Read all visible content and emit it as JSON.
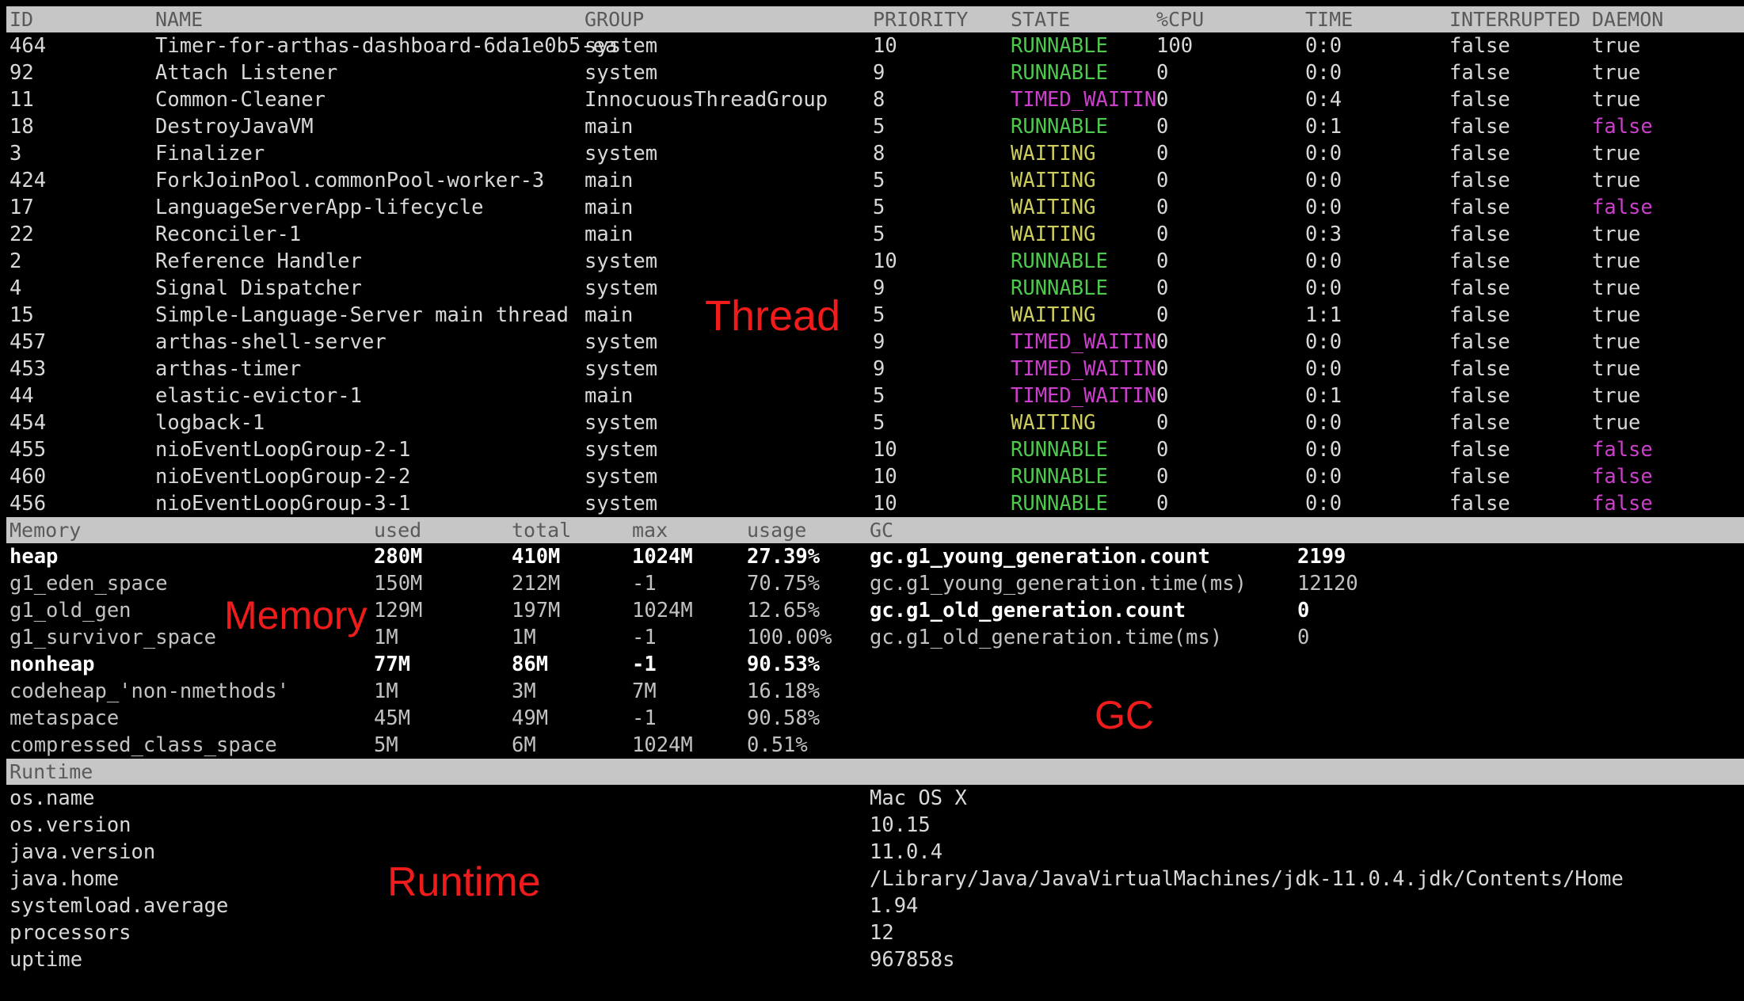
{
  "annotations": {
    "thread": "Thread",
    "memory": "Memory",
    "gc": "GC",
    "runtime": "Runtime",
    "color": "#f01c1c"
  },
  "thread_table": {
    "headers": {
      "id": "ID",
      "name": "NAME",
      "group": "GROUP",
      "priority": "PRIORITY",
      "state": "STATE",
      "cpu": "%CPU",
      "time": "TIME",
      "interrupted": "INTERRUPTED",
      "daemon": "DAEMON"
    },
    "rows": [
      {
        "id": "464",
        "name": "Timer-for-arthas-dashboard-6da1e0b5-ea",
        "group": "system",
        "priority": "10",
        "state": "RUNNABLE",
        "state_color": "green",
        "cpu": "100",
        "time": "0:0",
        "interrupted": "false",
        "daemon": "true",
        "daemon_color": "white"
      },
      {
        "id": "92",
        "name": "Attach Listener",
        "group": "system",
        "priority": "9",
        "state": "RUNNABLE",
        "state_color": "green",
        "cpu": "0",
        "time": "0:0",
        "interrupted": "false",
        "daemon": "true",
        "daemon_color": "white"
      },
      {
        "id": "11",
        "name": "Common-Cleaner",
        "group": "InnocuousThreadGroup",
        "priority": "8",
        "state": "TIMED_WAITIN",
        "state_color": "magenta",
        "cpu": "0",
        "time": "0:4",
        "interrupted": "false",
        "daemon": "true",
        "daemon_color": "white"
      },
      {
        "id": "18",
        "name": "DestroyJavaVM",
        "group": "main",
        "priority": "5",
        "state": "RUNNABLE",
        "state_color": "green",
        "cpu": "0",
        "time": "0:1",
        "interrupted": "false",
        "daemon": "false",
        "daemon_color": "magenta"
      },
      {
        "id": "3",
        "name": "Finalizer",
        "group": "system",
        "priority": "8",
        "state": "WAITING",
        "state_color": "yellow",
        "cpu": "0",
        "time": "0:0",
        "interrupted": "false",
        "daemon": "true",
        "daemon_color": "white"
      },
      {
        "id": "424",
        "name": "ForkJoinPool.commonPool-worker-3",
        "group": "main",
        "priority": "5",
        "state": "WAITING",
        "state_color": "yellow",
        "cpu": "0",
        "time": "0:0",
        "interrupted": "false",
        "daemon": "true",
        "daemon_color": "white"
      },
      {
        "id": "17",
        "name": "LanguageServerApp-lifecycle",
        "group": "main",
        "priority": "5",
        "state": "WAITING",
        "state_color": "yellow",
        "cpu": "0",
        "time": "0:0",
        "interrupted": "false",
        "daemon": "false",
        "daemon_color": "magenta"
      },
      {
        "id": "22",
        "name": "Reconciler-1",
        "group": "main",
        "priority": "5",
        "state": "WAITING",
        "state_color": "yellow",
        "cpu": "0",
        "time": "0:3",
        "interrupted": "false",
        "daemon": "true",
        "daemon_color": "white"
      },
      {
        "id": "2",
        "name": "Reference Handler",
        "group": "system",
        "priority": "10",
        "state": "RUNNABLE",
        "state_color": "green",
        "cpu": "0",
        "time": "0:0",
        "interrupted": "false",
        "daemon": "true",
        "daemon_color": "white"
      },
      {
        "id": "4",
        "name": "Signal Dispatcher",
        "group": "system",
        "priority": "9",
        "state": "RUNNABLE",
        "state_color": "green",
        "cpu": "0",
        "time": "0:0",
        "interrupted": "false",
        "daemon": "true",
        "daemon_color": "white"
      },
      {
        "id": "15",
        "name": "Simple-Language-Server main thread",
        "group": "main",
        "priority": "5",
        "state": "WAITING",
        "state_color": "yellow",
        "cpu": "0",
        "time": "1:1",
        "interrupted": "false",
        "daemon": "true",
        "daemon_color": "white"
      },
      {
        "id": "457",
        "name": "arthas-shell-server",
        "group": "system",
        "priority": "9",
        "state": "TIMED_WAITIN",
        "state_color": "magenta",
        "cpu": "0",
        "time": "0:0",
        "interrupted": "false",
        "daemon": "true",
        "daemon_color": "white"
      },
      {
        "id": "453",
        "name": "arthas-timer",
        "group": "system",
        "priority": "9",
        "state": "TIMED_WAITIN",
        "state_color": "magenta",
        "cpu": "0",
        "time": "0:0",
        "interrupted": "false",
        "daemon": "true",
        "daemon_color": "white"
      },
      {
        "id": "44",
        "name": "elastic-evictor-1",
        "group": "main",
        "priority": "5",
        "state": "TIMED_WAITIN",
        "state_color": "magenta",
        "cpu": "0",
        "time": "0:1",
        "interrupted": "false",
        "daemon": "true",
        "daemon_color": "white"
      },
      {
        "id": "454",
        "name": "logback-1",
        "group": "system",
        "priority": "5",
        "state": "WAITING",
        "state_color": "yellow",
        "cpu": "0",
        "time": "0:0",
        "interrupted": "false",
        "daemon": "true",
        "daemon_color": "white"
      },
      {
        "id": "455",
        "name": "nioEventLoopGroup-2-1",
        "group": "system",
        "priority": "10",
        "state": "RUNNABLE",
        "state_color": "green",
        "cpu": "0",
        "time": "0:0",
        "interrupted": "false",
        "daemon": "false",
        "daemon_color": "magenta"
      },
      {
        "id": "460",
        "name": "nioEventLoopGroup-2-2",
        "group": "system",
        "priority": "10",
        "state": "RUNNABLE",
        "state_color": "green",
        "cpu": "0",
        "time": "0:0",
        "interrupted": "false",
        "daemon": "false",
        "daemon_color": "magenta"
      },
      {
        "id": "456",
        "name": "nioEventLoopGroup-3-1",
        "group": "system",
        "priority": "10",
        "state": "RUNNABLE",
        "state_color": "green",
        "cpu": "0",
        "time": "0:0",
        "interrupted": "false",
        "daemon": "false",
        "daemon_color": "magenta"
      }
    ]
  },
  "memory_table": {
    "headers": {
      "memory": "Memory",
      "used": "used",
      "total": "total",
      "max": "max",
      "usage": "usage",
      "gc": "GC"
    },
    "rows": [
      {
        "name": "heap",
        "used": "280M",
        "total": "410M",
        "max": "1024M",
        "usage": "27.39%",
        "bold": true
      },
      {
        "name": "g1_eden_space",
        "used": "150M",
        "total": "212M",
        "max": "-1",
        "usage": "70.75%",
        "bold": false
      },
      {
        "name": "g1_old_gen",
        "used": "129M",
        "total": "197M",
        "max": "1024M",
        "usage": "12.65%",
        "bold": false
      },
      {
        "name": "g1_survivor_space",
        "used": "1M",
        "total": "1M",
        "max": "-1",
        "usage": "100.00%",
        "bold": false
      },
      {
        "name": "nonheap",
        "used": "77M",
        "total": "86M",
        "max": "-1",
        "usage": "90.53%",
        "bold": true
      },
      {
        "name": "codeheap_'non-nmethods'",
        "used": "1M",
        "total": "3M",
        "max": "7M",
        "usage": "16.18%",
        "bold": false
      },
      {
        "name": "metaspace",
        "used": "45M",
        "total": "49M",
        "max": "-1",
        "usage": "90.58%",
        "bold": false
      },
      {
        "name": "compressed_class_space",
        "used": "5M",
        "total": "6M",
        "max": "1024M",
        "usage": "0.51%",
        "bold": false
      }
    ],
    "gc_rows": [
      {
        "name": "gc.g1_young_generation.count",
        "value": "2199",
        "bold": true
      },
      {
        "name": "gc.g1_young_generation.time(ms)",
        "value": "12120",
        "bold": false
      },
      {
        "name": "gc.g1_old_generation.count",
        "value": "0",
        "bold": true
      },
      {
        "name": "gc.g1_old_generation.time(ms)",
        "value": "0",
        "bold": false
      }
    ]
  },
  "runtime_table": {
    "header": "Runtime",
    "rows": [
      {
        "key": "os.name",
        "value": "Mac OS X"
      },
      {
        "key": "os.version",
        "value": "10.15"
      },
      {
        "key": "java.version",
        "value": "11.0.4"
      },
      {
        "key": "java.home",
        "value": "/Library/Java/JavaVirtualMachines/jdk-11.0.4.jdk/Contents/Home"
      },
      {
        "key": "systemload.average",
        "value": "1.94"
      },
      {
        "key": "processors",
        "value": "12"
      },
      {
        "key": "uptime",
        "value": "967858s"
      }
    ]
  }
}
